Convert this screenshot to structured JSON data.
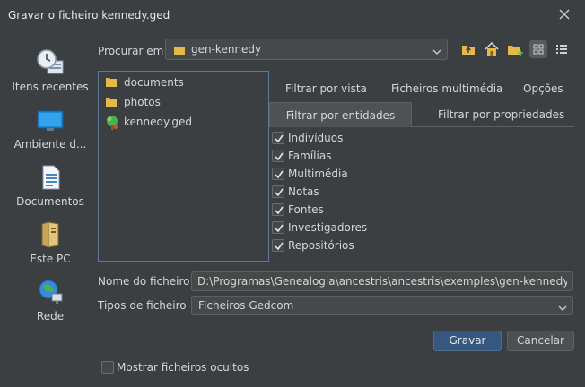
{
  "window": {
    "title": "Gravar o ficheiro kennedy.ged"
  },
  "places": [
    {
      "label": "Itens recentes",
      "icon": "recent-items-icon"
    },
    {
      "label": "Ambiente d...",
      "icon": "desktop-icon"
    },
    {
      "label": "Documentos",
      "icon": "documents-icon"
    },
    {
      "label": "Este PC",
      "icon": "computer-icon"
    },
    {
      "label": "Rede",
      "icon": "network-icon"
    }
  ],
  "lookin": {
    "label": "Procurar em",
    "value": "gen-kennedy"
  },
  "files": [
    {
      "name": "documents",
      "icon": "folder-icon"
    },
    {
      "name": "photos",
      "icon": "folder-icon"
    },
    {
      "name": "kennedy.ged",
      "icon": "gedcom-tree-icon"
    }
  ],
  "tabs": {
    "row1": [
      "Filtrar por vista",
      "Ficheiros multimédia",
      "Opções"
    ],
    "row2": [
      "Filtrar por entidades",
      "Filtrar por propriedades"
    ],
    "selected": "Filtrar por entidades"
  },
  "entities": [
    {
      "label": "Indivíduos",
      "checked": true
    },
    {
      "label": "Famílias",
      "checked": true
    },
    {
      "label": "Multimédia",
      "checked": true
    },
    {
      "label": "Notas",
      "checked": true
    },
    {
      "label": "Fontes",
      "checked": true
    },
    {
      "label": "Investigadores",
      "checked": true
    },
    {
      "label": "Repositórios",
      "checked": true
    }
  ],
  "filename": {
    "label": "Nome do ficheiro",
    "value": "D:\\Programas\\Genealogia\\ancestris\\ancestris\\exemples\\gen-kennedy"
  },
  "filetype": {
    "label": "Tipos de ficheiro",
    "value": "Ficheiros Gedcom"
  },
  "buttons": {
    "save": "Gravar",
    "cancel": "Cancelar"
  },
  "show_hidden": {
    "label": "Mostrar ficheiros ocultos",
    "checked": false
  },
  "colors": {
    "background": "#3c3f41",
    "accent": "#365880",
    "folder": "#e5b84a",
    "selection_border": "#5a7b9a"
  }
}
